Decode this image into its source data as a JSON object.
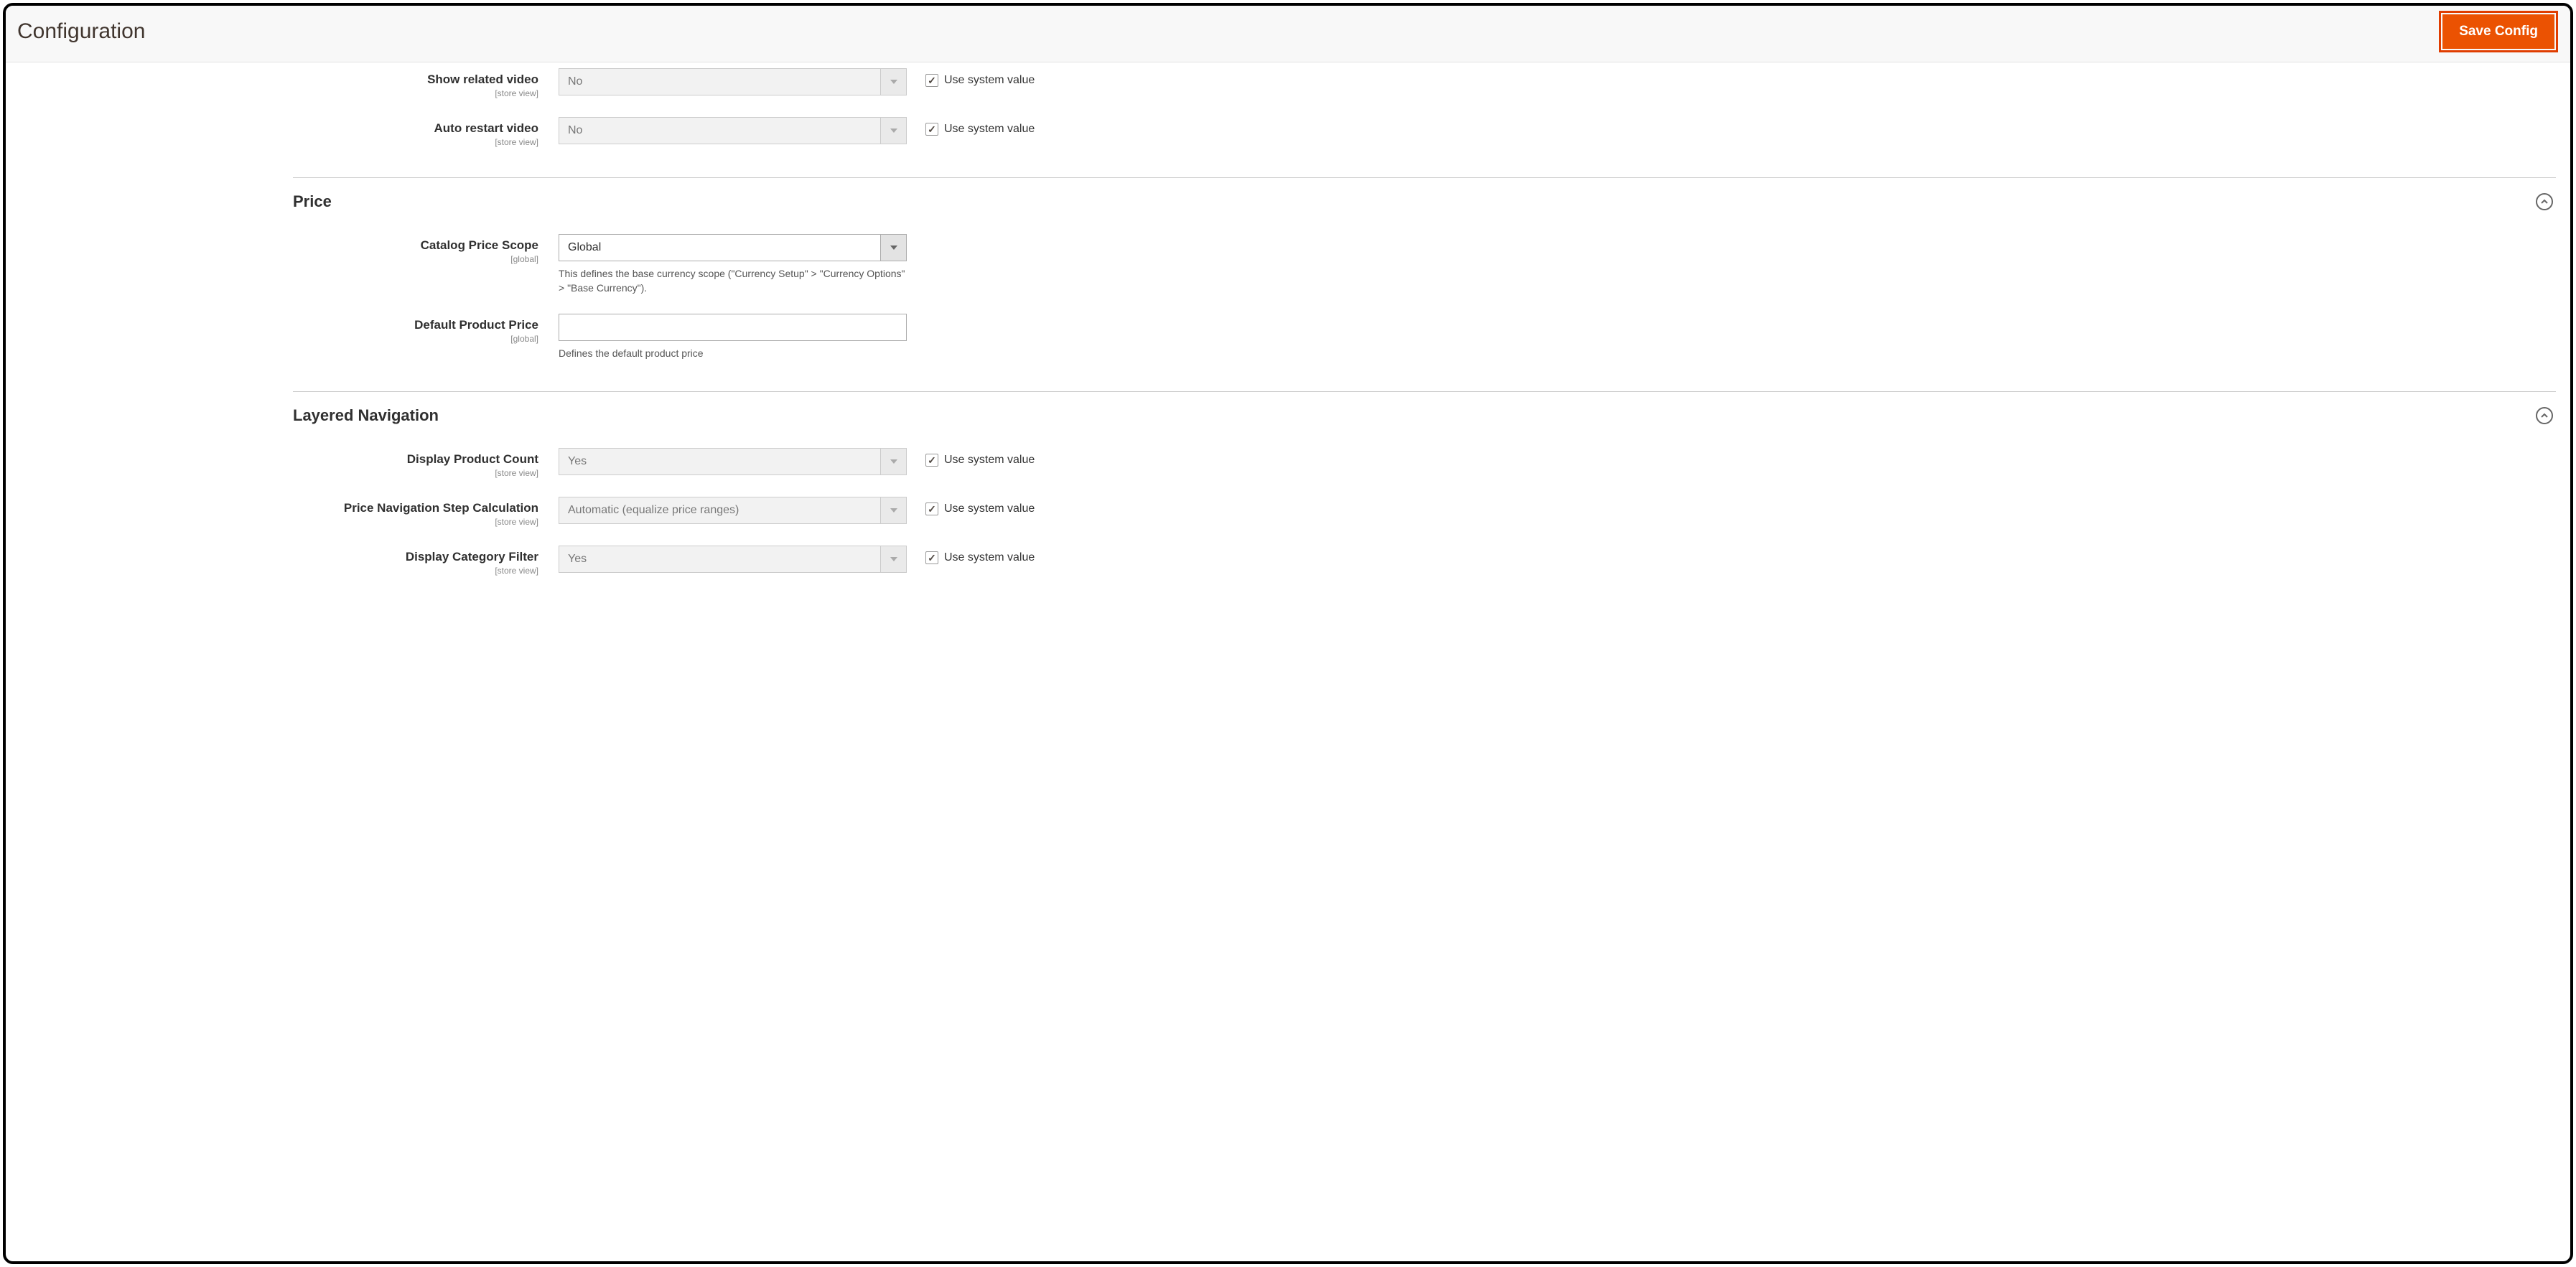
{
  "page": {
    "title": "Configuration",
    "save_button": "Save Config"
  },
  "common": {
    "use_system_value": "Use system value"
  },
  "scope": {
    "store_view": "[store view]",
    "global": "[global]"
  },
  "video_fields": {
    "show_related": {
      "label": "Show related video",
      "value": "No",
      "scope": "[store view]",
      "use_system": true
    },
    "auto_restart": {
      "label": "Auto restart video",
      "value": "No",
      "scope": "[store view]",
      "use_system": true
    }
  },
  "sections": {
    "price": {
      "heading": "Price",
      "fields": {
        "scope": {
          "label": "Catalog Price Scope",
          "value": "Global",
          "scope": "[global]",
          "note": "This defines the base currency scope (\"Currency Setup\" > \"Currency Options\" > \"Base Currency\")."
        },
        "default_price": {
          "label": "Default Product Price",
          "value": "",
          "scope": "[global]",
          "note": "Defines the default product price"
        }
      }
    },
    "layered_nav": {
      "heading": "Layered Navigation",
      "fields": {
        "display_count": {
          "label": "Display Product Count",
          "value": "Yes",
          "scope": "[store view]",
          "use_system": true
        },
        "step_calc": {
          "label": "Price Navigation Step Calculation",
          "value": "Automatic (equalize price ranges)",
          "scope": "[store view]",
          "use_system": true
        },
        "display_category_filter": {
          "label": "Display Category Filter",
          "value": "Yes",
          "scope": "[store view]",
          "use_system": true
        }
      }
    }
  }
}
